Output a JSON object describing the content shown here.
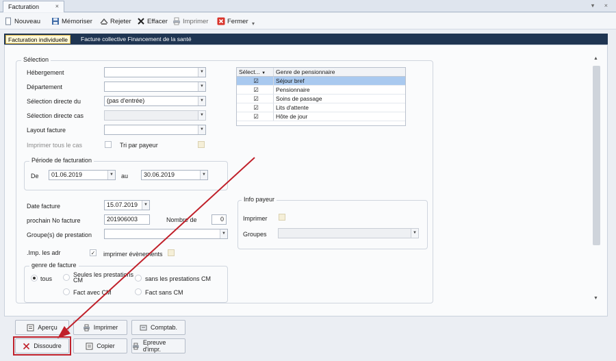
{
  "window": {
    "tab_title": "Facturation",
    "tab_close": "×",
    "controls": "▾ ×"
  },
  "toolbar": {
    "new": "Nouveau",
    "save": "Mémoriser",
    "reject": "Rejeter",
    "delete": "Effacer",
    "print": "Imprimer",
    "close": "Fermer"
  },
  "tabs": {
    "individual": "Facturation individuelle",
    "collective": "Facture collective Financement de la santé"
  },
  "selection": {
    "group_title": "Sélection",
    "hebergement": {
      "label": "Hébergement",
      "value": ""
    },
    "departement": {
      "label": "Département",
      "value": ""
    },
    "selection_directe_du": {
      "label": "Sélection directe du",
      "value": "(pas d'entrée)"
    },
    "selection_directe_cas": {
      "label": "Sélection directe cas",
      "value": ""
    },
    "layout_facture": {
      "label": "Layout facture",
      "value": ""
    },
    "imprimer_tous": "Imprimer tous le cas",
    "tri_par_payeur": "Tri par payeur"
  },
  "grid": {
    "col1": "Sélect...",
    "col2": "Genre de pensionnaire",
    "rows": [
      {
        "checked": true,
        "name": "Séjour bref"
      },
      {
        "checked": true,
        "name": "Pensionnaire"
      },
      {
        "checked": true,
        "name": "Soins de passage"
      },
      {
        "checked": true,
        "name": "Lits d'attente"
      },
      {
        "checked": true,
        "name": "Hôte de jour"
      }
    ]
  },
  "periode": {
    "title": "Période de facturation",
    "from_label": "De",
    "from": "01.06.2019",
    "to_label": "au",
    "to": "30.06.2019"
  },
  "invoice": {
    "date_label": "Date facture",
    "date": "15.07.2019",
    "next_no_label": "prochain No facture",
    "next_no": "201906003",
    "nombre_label": "Nombre de",
    "nombre": "0",
    "groupes_label": "Groupe(s) de prestation",
    "groupes": "",
    "imp_adr_label": ".Imp. les adr",
    "imprimer_evenements": "imprimer évènements"
  },
  "genre_facture": {
    "title": "genre de facture",
    "tous": "tous",
    "seules_cm": "Seules les prestations CM",
    "sans_cm": "sans les prestations CM",
    "fact_avec_cm": "Fact avec CM",
    "fact_sans_cm": "Fact sans CM"
  },
  "info_payeur": {
    "title": "Info payeur",
    "imprimer": "Imprimer",
    "groupes": "Groupes"
  },
  "buttons": {
    "apercu": "Aperçu",
    "imprimer": "Imprimer",
    "comptab": "Comptab.",
    "dissoudre": "Dissoudre",
    "copier": "Copier",
    "epreuve": "Epreuve d'impr."
  },
  "colors": {
    "accent_red": "#c0202a",
    "tabbar": "#1f3552",
    "selected_row": "#a9c9ef"
  }
}
